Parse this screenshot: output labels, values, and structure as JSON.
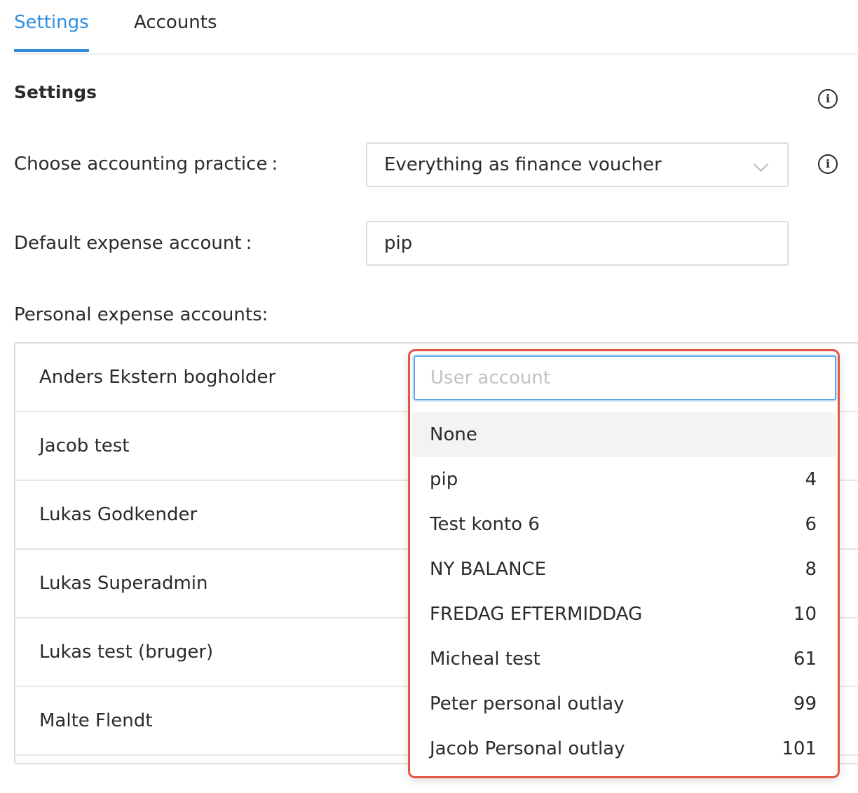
{
  "tabs": [
    {
      "label": "Settings",
      "active": true
    },
    {
      "label": "Accounts",
      "active": false
    }
  ],
  "section": {
    "title": "Settings"
  },
  "practice": {
    "label": "Choose accounting practice",
    "colon": ":",
    "value": "Everything as finance voucher"
  },
  "expense": {
    "label": "Default expense account",
    "colon": ":",
    "value": "pip"
  },
  "personal": {
    "label": "Personal expense accounts:",
    "rows": [
      {
        "name": "Anders Ekstern bogholder"
      },
      {
        "name": "Jacob test"
      },
      {
        "name": "Lukas Godkender"
      },
      {
        "name": "Lukas Superadmin"
      },
      {
        "name": "Lukas test (bruger)"
      },
      {
        "name": "Malte Flendt"
      }
    ]
  },
  "dropdown": {
    "placeholder": "User account",
    "options": [
      {
        "name": "None",
        "number": ""
      },
      {
        "name": "pip",
        "number": "4"
      },
      {
        "name": "Test konto 6",
        "number": "6"
      },
      {
        "name": "NY BALANCE",
        "number": "8"
      },
      {
        "name": "FREDAG EFTERMIDDAG",
        "number": "10"
      },
      {
        "name": "Micheal test",
        "number": "61"
      },
      {
        "name": "Peter personal outlay",
        "number": "99"
      },
      {
        "name": "Jacob Personal outlay",
        "number": "101"
      }
    ]
  },
  "colors": {
    "accent": "#2f8ee0",
    "highlight_border": "#e05744",
    "focus_border": "#5aa9e8"
  },
  "icons": {
    "info": "info-circle-icon",
    "chevron": "chevron-down-icon"
  }
}
